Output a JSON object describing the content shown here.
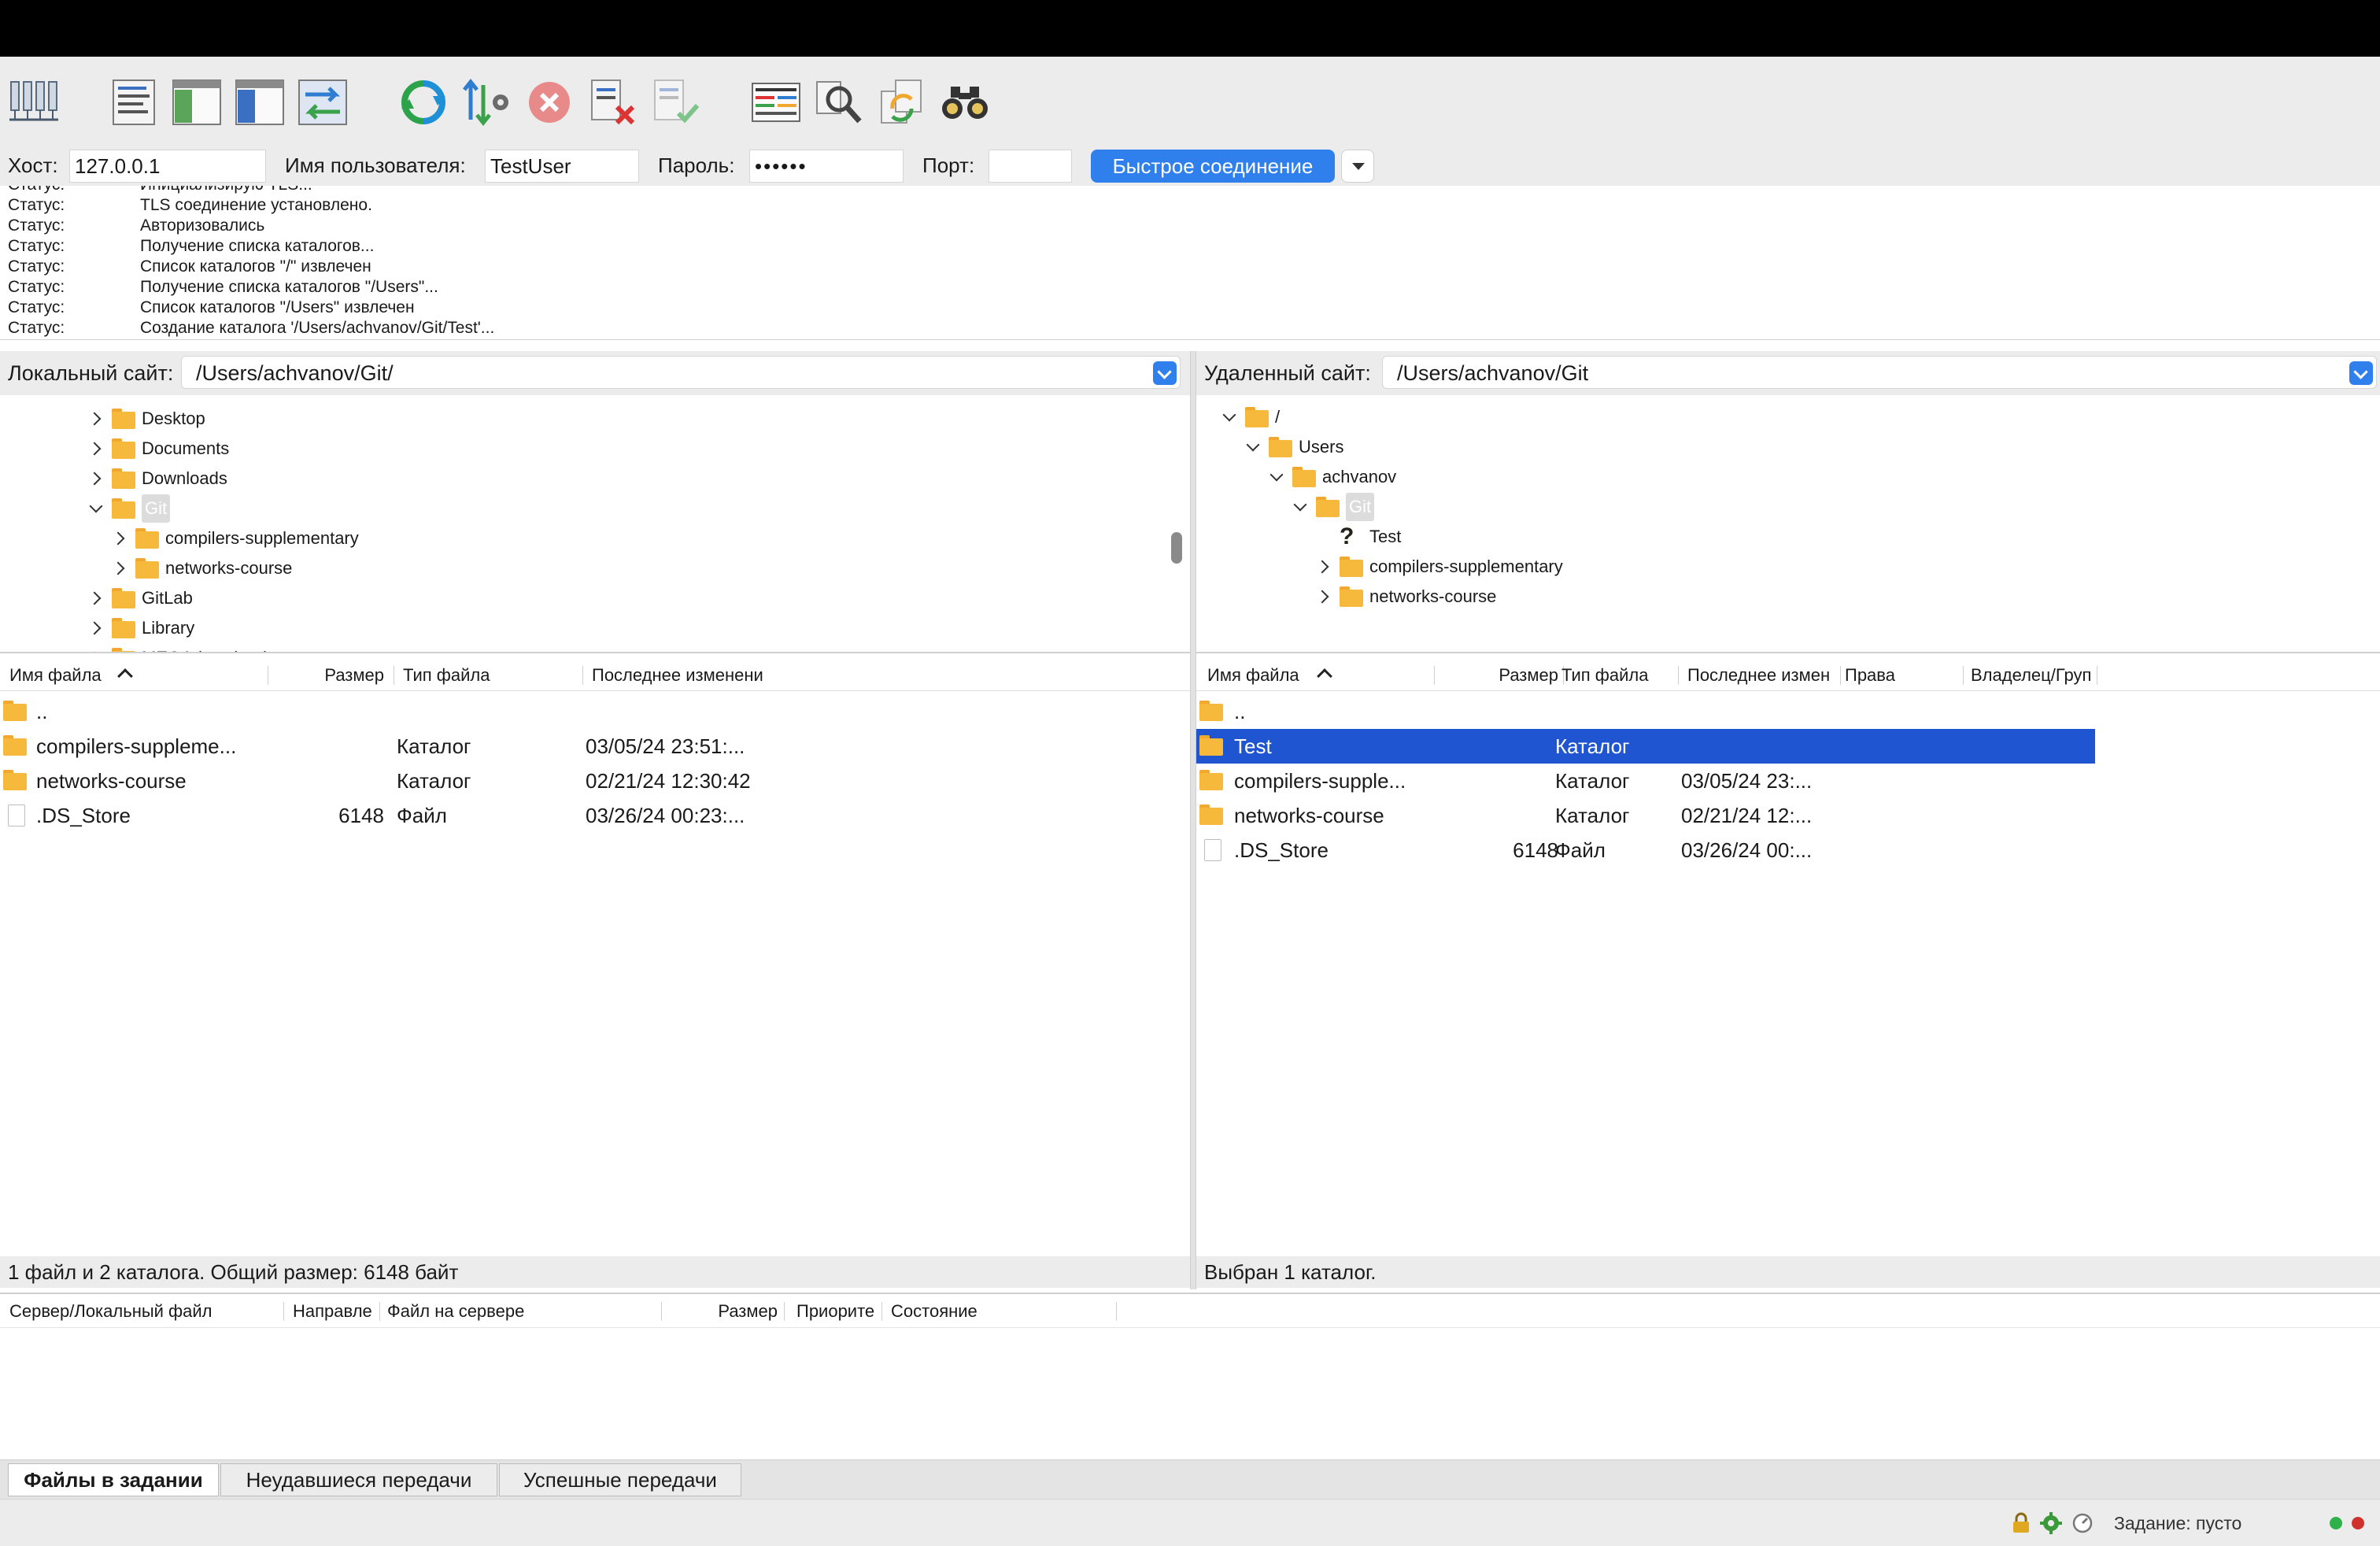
{
  "toolbar": {
    "icons": [
      "site-manager-icon",
      "toggle-log-icon",
      "toggle-local-tree-icon",
      "toggle-remote-tree-icon",
      "toggle-queue-icon",
      "refresh-icon",
      "process-queue-icon",
      "cancel-icon",
      "disconnect-icon",
      "reconnect-icon",
      "directory-filter-icon",
      "compare-icon",
      "sync-browse-icon",
      "search-icon"
    ]
  },
  "quickconnect": {
    "host_label": "Хост:",
    "host_value": "127.0.0.1",
    "user_label": "Имя пользователя:",
    "user_value": "TestUser",
    "pass_label": "Пароль:",
    "pass_value": "••••••",
    "port_label": "Порт:",
    "port_value": "",
    "button_label": "Быстрое соединение"
  },
  "log": [
    {
      "k": "Статус:",
      "v": "Инициализирую TLS..."
    },
    {
      "k": "Статус:",
      "v": "TLS соединение установлено."
    },
    {
      "k": "Статус:",
      "v": "Авторизовались"
    },
    {
      "k": "Статус:",
      "v": "Получение списка каталогов..."
    },
    {
      "k": "Статус:",
      "v": "Список каталогов \"/\" извлечен"
    },
    {
      "k": "Статус:",
      "v": "Получение списка каталогов \"/Users\"..."
    },
    {
      "k": "Статус:",
      "v": "Список каталогов \"/Users\" извлечен"
    },
    {
      "k": "Статус:",
      "v": "Создание каталога '/Users/achvanov/Git/Test'..."
    }
  ],
  "local": {
    "site_label": "Локальный сайт:",
    "path": "/Users/achvanov/Git/",
    "tree": [
      {
        "name": "Desktop",
        "chev": "r",
        "depth": 0
      },
      {
        "name": "Documents",
        "chev": "r",
        "depth": 0
      },
      {
        "name": "Downloads",
        "chev": "r",
        "depth": 0
      },
      {
        "name": "Git",
        "chev": "d",
        "depth": 0,
        "selected": true
      },
      {
        "name": "compilers-supplementary",
        "chev": "r",
        "depth": 1
      },
      {
        "name": "networks-course",
        "chev": "r",
        "depth": 1
      },
      {
        "name": "GitLab",
        "chev": "r",
        "depth": 0
      },
      {
        "name": "Library",
        "chev": "r",
        "depth": 0
      },
      {
        "name": "MEGAdownload",
        "chev": "r",
        "depth": 0
      }
    ],
    "columns": {
      "name": "Имя файла",
      "size": "Размер",
      "type": "Тип файла",
      "modified": "Последнее изменени"
    },
    "files": [
      {
        "name": "..",
        "size": "",
        "type": "",
        "modified": "",
        "icon": "folder"
      },
      {
        "name": "compilers-suppleme...",
        "size": "",
        "type": "Каталог",
        "modified": "03/05/24 23:51:...",
        "icon": "folder"
      },
      {
        "name": "networks-course",
        "size": "",
        "type": "Каталог",
        "modified": "02/21/24 12:30:42",
        "icon": "folder"
      },
      {
        "name": ".DS_Store",
        "size": "6148",
        "type": "Файл",
        "modified": "03/26/24 00:23:...",
        "icon": "file"
      }
    ],
    "status": "1 файл и 2 каталога. Общий размер: 6148 байт"
  },
  "remote": {
    "site_label": "Удаленный сайт:",
    "path": "/Users/achvanov/Git",
    "tree": [
      {
        "name": "/",
        "chev": "d",
        "depth": 0
      },
      {
        "name": "Users",
        "chev": "d",
        "depth": 1
      },
      {
        "name": "achvanov",
        "chev": "d",
        "depth": 2
      },
      {
        "name": "Git",
        "chev": "d",
        "depth": 3,
        "selected": true
      },
      {
        "name": "Test",
        "chev": "",
        "depth": 4,
        "unknown": true
      },
      {
        "name": "compilers-supplementary",
        "chev": "r",
        "depth": 4
      },
      {
        "name": "networks-course",
        "chev": "r",
        "depth": 4
      }
    ],
    "columns": {
      "name": "Имя файла",
      "size": "Размер",
      "type": "Тип файла",
      "modified": "Последнее измен",
      "perms": "Права",
      "owner": "Владелец/Груп"
    },
    "files": [
      {
        "name": "..",
        "size": "",
        "type": "",
        "modified": "",
        "icon": "folder"
      },
      {
        "name": "Test",
        "size": "",
        "type": "Каталог",
        "modified": "",
        "icon": "folder",
        "selected": true
      },
      {
        "name": "compilers-supple...",
        "size": "",
        "type": "Каталог",
        "modified": "03/05/24 23:...",
        "icon": "folder"
      },
      {
        "name": "networks-course",
        "size": "",
        "type": "Каталог",
        "modified": "02/21/24 12:...",
        "icon": "folder"
      },
      {
        "name": ".DS_Store",
        "size": "6148",
        "type": "Файл",
        "modified": "03/26/24 00:...",
        "icon": "file"
      }
    ],
    "status": "Выбран 1 каталог."
  },
  "queue": {
    "columns": [
      "Сервер/Локальный файл",
      "Направле",
      "Файл на сервере",
      "Размер",
      "Приорите",
      "Состояние"
    ]
  },
  "tabs": [
    {
      "label": "Файлы в задании",
      "active": true
    },
    {
      "label": "Неудавшиеся передачи",
      "active": false
    },
    {
      "label": "Успешные передачи",
      "active": false
    }
  ],
  "statusbar": {
    "queue_text": "Задание: пусто"
  },
  "colors": {
    "accent": "#2f80ed",
    "selection": "#1f55d0",
    "folder": "#f6b93b",
    "led_green": "#2fb14a",
    "led_red": "#d0312d"
  }
}
